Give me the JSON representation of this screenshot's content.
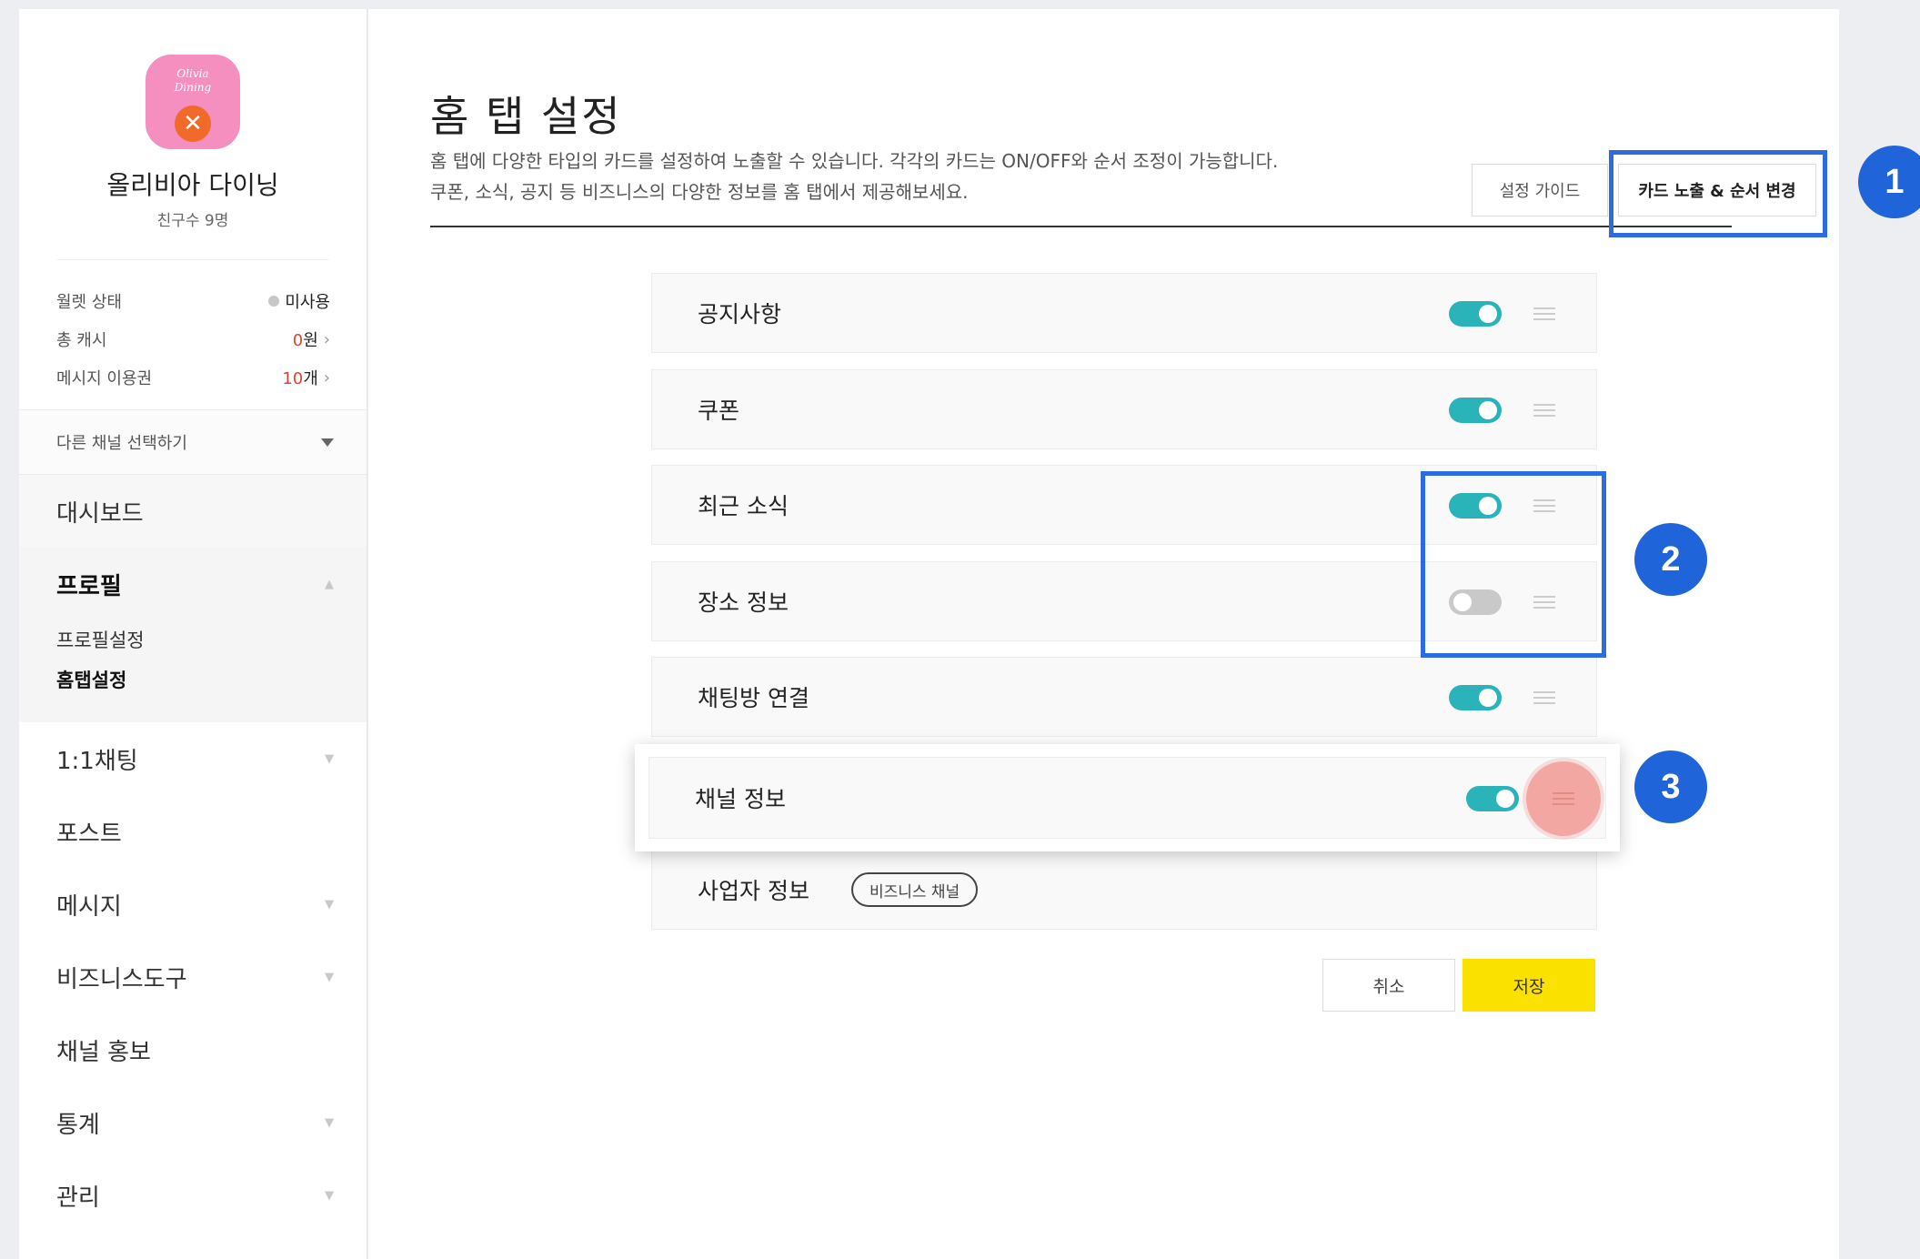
{
  "sidebar": {
    "logo_text": "Olivia\nDining",
    "channel_name": "올리비아 다이닝",
    "friend_count": "친구수 9명",
    "stats": [
      {
        "label": "월렛 상태",
        "value": "미사용"
      },
      {
        "label": "총 캐시",
        "num": "0",
        "unit": "원"
      },
      {
        "label": "메시지 이용권",
        "num": "10",
        "unit": "개"
      }
    ],
    "channel_select": "다른 채널 선택하기",
    "nav": [
      {
        "label": "대시보드"
      },
      {
        "label": "프로필"
      },
      {
        "label": "1:1채팅"
      },
      {
        "label": "포스트"
      },
      {
        "label": "메시지"
      },
      {
        "label": "비즈니스도구"
      },
      {
        "label": "채널 홍보"
      },
      {
        "label": "통계"
      },
      {
        "label": "관리"
      }
    ],
    "profile_sub": [
      "프로필설정",
      "홈탭설정"
    ]
  },
  "main": {
    "title": "홈 탭 설정",
    "desc_line1": "홈 탭에 다양한 타입의 카드를 설정하여 노출할 수 있습니다. 각각의 카드는 ON/OFF와 순서 조정이 가능합니다.",
    "desc_line2": "쿠폰, 소식, 공지 등 비즈니스의 다양한 정보를 홈 탭에서 제공해보세요.",
    "guide_button": "설정 가이드",
    "order_button": "카드 노출 & 순서 변경",
    "cards": [
      {
        "label": "공지사항",
        "on": true
      },
      {
        "label": "쿠폰",
        "on": true
      },
      {
        "label": "최근 소식",
        "on": true
      },
      {
        "label": "장소 정보",
        "on": false
      },
      {
        "label": "채팅방 연결",
        "on": true
      },
      {
        "label": "채널 정보",
        "on": true
      }
    ],
    "business_card": {
      "label": "사업자 정보",
      "tag": "비즈니스 채널"
    },
    "cancel_button": "취소",
    "save_button": "저장"
  },
  "steps": [
    "1",
    "2",
    "3"
  ],
  "colors": {
    "toggle_on": "#2ab3b9",
    "toggle_off": "#c9c9c9",
    "save": "#fae100",
    "highlight": "#2d6be0",
    "step_badge": "#1f64d8"
  }
}
